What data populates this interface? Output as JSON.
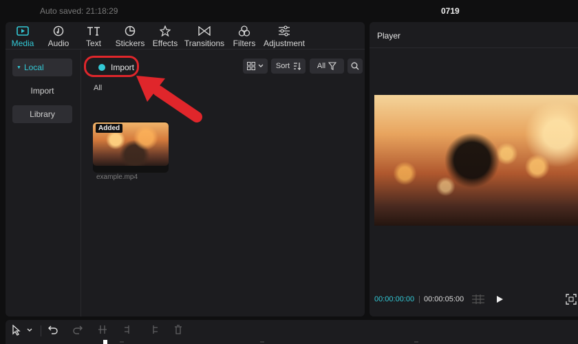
{
  "header": {
    "autosave": "Auto saved: 21:18:29",
    "project_name": "0719"
  },
  "tabs": [
    {
      "label": "Media",
      "icon": "media-icon",
      "active": true
    },
    {
      "label": "Audio",
      "icon": "audio-icon"
    },
    {
      "label": "Text",
      "icon": "text-icon"
    },
    {
      "label": "Stickers",
      "icon": "stickers-icon"
    },
    {
      "label": "Effects",
      "icon": "effects-icon"
    },
    {
      "label": "Transitions",
      "icon": "transitions-icon"
    },
    {
      "label": "Filters",
      "icon": "filters-icon"
    },
    {
      "label": "Adjustment",
      "icon": "adjustment-icon"
    }
  ],
  "sidebar": {
    "items": [
      {
        "label": "Local",
        "active": true
      },
      {
        "label": "Import"
      },
      {
        "label": "Library"
      }
    ]
  },
  "toolbar": {
    "import_label": "Import",
    "sort_label": "Sort",
    "filter_label": "All"
  },
  "filter_current": "All",
  "media": {
    "items": [
      {
        "name": "example.mp4",
        "badge": "Added"
      }
    ]
  },
  "player": {
    "title": "Player",
    "time_current": "00:00:00:00",
    "time_total": "00:00:05:00"
  },
  "colors": {
    "accent": "#33c9d6",
    "highlight": "#e0262b",
    "panel": "#1c1c1f",
    "background": "#0f0f10"
  }
}
